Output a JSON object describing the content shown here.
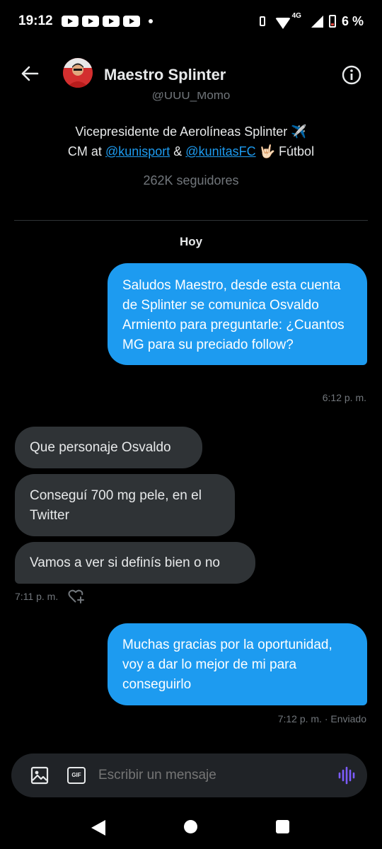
{
  "status_bar": {
    "time": "19:12",
    "network": "4G",
    "battery": "6 %"
  },
  "header": {
    "back_icon": "arrow-left-icon",
    "title": "Maestro Splinter",
    "info_icon": "info-icon"
  },
  "profile": {
    "handle": "@UUU_Momo",
    "bio_line1": "Vicepresidente de Aerolíneas Splinter ✈️",
    "bio_cm": "CM at",
    "bio_link1": "@kunisport",
    "bio_amp": "&",
    "bio_link2": "@kunitasFC",
    "bio_end": "🤟🏻 Fútbol",
    "followers": "262K seguidores"
  },
  "conversation": {
    "day_label": "Hoy",
    "messages": [
      {
        "direction": "out",
        "text": "Saludos Maestro, desde esta cuenta de Splinter se comunica Osvaldo Armiento para preguntarle: ¿Cuantos MG para su preciado follow?",
        "time": "6:12 p. m."
      },
      {
        "direction": "in",
        "text": "Que personaje Osvaldo"
      },
      {
        "direction": "in",
        "text": "Conseguí 700 mg pele, en el Twitter"
      },
      {
        "direction": "in",
        "text": "Vamos a ver si definís bien o no",
        "time": "7:11 p. m."
      },
      {
        "direction": "out",
        "text": "Muchas gracias por la oportunidad, voy a dar lo mejor de mi para conseguirlo",
        "time": "7:12 p. m.",
        "status": "· Enviado"
      }
    ]
  },
  "composer": {
    "placeholder": "Escribir un mensaje",
    "image_icon": "image-icon",
    "gif_label": "GIF",
    "voice_icon": "voice-wave-icon"
  },
  "colors": {
    "accent": "#1d9bf0",
    "background": "#000000",
    "incoming_bubble": "#2f3336",
    "muted_text": "#71767b",
    "voice_icon": "#7c5cff"
  }
}
